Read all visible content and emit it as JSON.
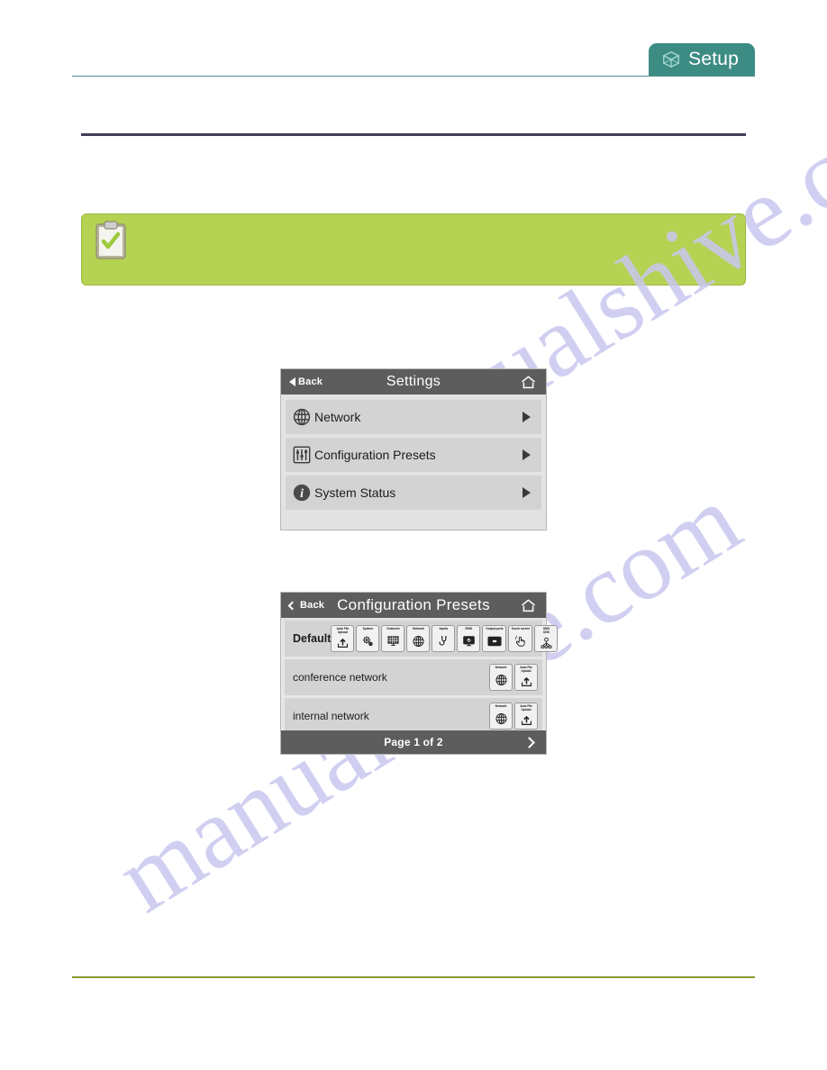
{
  "page": {
    "background": "#ffffff",
    "accent_teal": "#3d8c84",
    "accent_green": "#b5d253",
    "rule_dark": "#3f3d56",
    "rule_green": "#8a9b2e",
    "watermark_text": "manualshive.com",
    "watermark_color": "#c9c7ef"
  },
  "setup_tab": {
    "label": "Setup",
    "icon": "cube-icon",
    "color": "#3d8c84"
  },
  "note": {
    "icon": "clipboard-check-icon",
    "text": ""
  },
  "settings_screen": {
    "header": {
      "back_label": "Back",
      "title": "Settings",
      "home_icon": "home-icon"
    },
    "items": [
      {
        "label": "Network",
        "icon": "globe-icon"
      },
      {
        "label": "Configuration Presets",
        "icon": "sliders-icon"
      },
      {
        "label": "System Status",
        "icon": "info-icon"
      }
    ]
  },
  "presets_screen": {
    "header": {
      "back_label": "Back",
      "title": "Configuration Presets",
      "home_icon": "home-icon"
    },
    "rows": [
      {
        "name": "Default",
        "bold": true,
        "badges": [
          {
            "label": "Auto File\nUpload",
            "icon": "upload-icon"
          },
          {
            "label": "System",
            "icon": "gears-icon"
          },
          {
            "label": "Channels",
            "icon": "channels-icon"
          },
          {
            "label": "Network",
            "icon": "globe-icon"
          },
          {
            "label": "Inputs",
            "icon": "plug-icon"
          },
          {
            "label": "EDID",
            "icon": "monitor-icon"
          },
          {
            "label": "Output ports",
            "icon": "output-port-icon"
          },
          {
            "label": "Touch screen",
            "icon": "touch-hand-icon"
          },
          {
            "label": "SMS\nDNS",
            "icon": "sms-dns-icon"
          }
        ]
      },
      {
        "name": "conference network",
        "bold": false,
        "badges": [
          {
            "label": "Network",
            "icon": "globe-icon"
          },
          {
            "label": "Auto File\nUpload",
            "icon": "upload-icon"
          }
        ]
      },
      {
        "name": "internal network",
        "bold": false,
        "badges": [
          {
            "label": "Network",
            "icon": "globe-icon"
          },
          {
            "label": "Auto File\nUpload",
            "icon": "upload-icon"
          }
        ]
      }
    ],
    "footer": {
      "page_text": "Page 1 of 2",
      "next_icon": "chevron-right-icon"
    }
  }
}
